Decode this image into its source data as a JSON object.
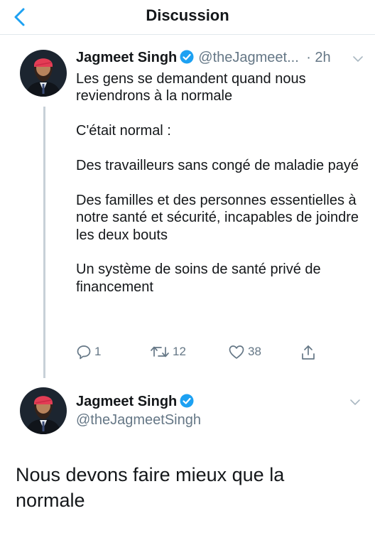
{
  "header": {
    "title": "Discussion"
  },
  "tweet1": {
    "name": "Jagmeet Singh",
    "handle": "@theJagmeet...",
    "time": "· 2h",
    "paragraphs": [
      "Les gens se demandent quand nous reviendrons à la normale",
      "C'était normal :",
      "Des travailleurs sans congé de maladie payé",
      "Des familles et des personnes essentielles à notre santé et sécurité, incapables de joindre les deux bouts",
      "Un système de soins de santé privé de financement"
    ],
    "actions": {
      "replies": "1",
      "retweets": "12",
      "likes": "38"
    }
  },
  "tweet2": {
    "name": "Jagmeet Singh",
    "handle": "@theJagmeetSingh",
    "text": "Nous devons faire mieux que la normale"
  },
  "colors": {
    "accent": "#1da1f2",
    "secondary": "#657786",
    "divider": "#e1e8ed"
  }
}
